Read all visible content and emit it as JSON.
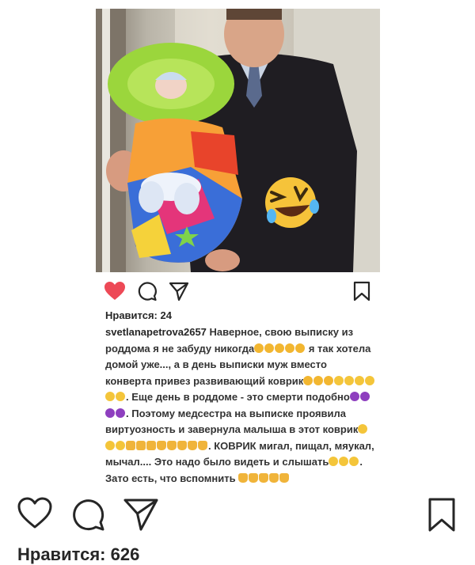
{
  "post": {
    "likes_label": "Нравится: 626"
  },
  "embedded_post": {
    "likes_label": "Нравится: 24",
    "username": "svetlanapetrova2657",
    "caption_parts": {
      "p1": " Наверное, свою выписку из роддома я не забуду никогда",
      "p2": " я так хотела домой уже..., а в день выписки муж вместо конверта привез развивающий коврик",
      "p3": ". Еще день в роддоме - это смерти подобно",
      "p4": ". Поэтому медсестра на выписке проявила виртуозность и завернула малыша в этот коврик",
      "p5": ". КОВРИК мигал, пищал, мяукал, мычал.... Это надо было видеть и слышать",
      "p6": ". Зато есть, что вспомнить "
    }
  },
  "icons": {
    "like": "heart-icon",
    "comment": "comment-icon",
    "share": "share-icon",
    "save": "bookmark-icon",
    "sticker": "laughing-emoji-icon"
  },
  "colors": {
    "liked_heart": "#ed4956",
    "text": "#262626"
  }
}
